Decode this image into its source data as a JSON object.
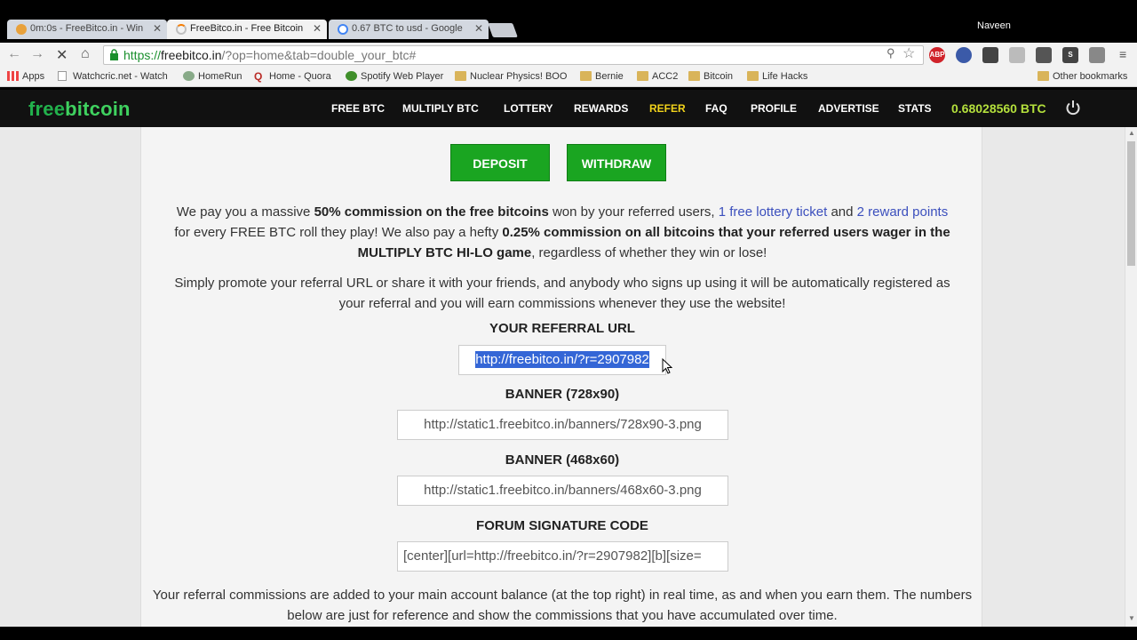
{
  "browser": {
    "tabs": [
      {
        "title": "0m:0s - FreeBitco.in - Win",
        "active": false
      },
      {
        "title": "FreeBitco.in - Free Bitcoin",
        "active": true
      },
      {
        "title": "0.67 BTC to usd - Google",
        "active": false
      }
    ],
    "user": "Naveen",
    "url_https": "https://",
    "url_host": "freebitco.in",
    "url_rest": "/?op=home&tab=double_your_btc#",
    "bookmarks": [
      {
        "label": "Apps",
        "icon": "apps-icon"
      },
      {
        "label": "Watchcric.net - Watch",
        "icon": "page-icon"
      },
      {
        "label": "HomeRun",
        "icon": "homerun-icon"
      },
      {
        "label": "Home - Quora",
        "icon": "quora-icon"
      },
      {
        "label": "Spotify Web Player",
        "icon": "spotify-icon"
      },
      {
        "label": "Nuclear Physics! BOO",
        "icon": "folder-icon"
      },
      {
        "label": "Bernie",
        "icon": "folder-icon"
      },
      {
        "label": "ACC2",
        "icon": "folder-icon"
      },
      {
        "label": "Bitcoin",
        "icon": "folder-icon"
      },
      {
        "label": "Life Hacks",
        "icon": "folder-icon"
      }
    ],
    "other_bookmarks": "Other bookmarks",
    "extensions": [
      "ABP"
    ]
  },
  "site": {
    "logo_a": "free",
    "logo_b": "bitcoin",
    "nav": [
      "FREE BTC",
      "MULTIPLY BTC",
      "LOTTERY",
      "REWARDS",
      "REFER",
      "FAQ",
      "PROFILE",
      "ADVERTISE",
      "STATS"
    ],
    "balance": "0.68028560 BTC"
  },
  "main": {
    "deposit": "DEPOSIT",
    "withdraw": "WITHDRAW",
    "p1": {
      "a": "We pay you a massive ",
      "b": "50% commission on the free bitcoins",
      "c": " won by your referred users, ",
      "d": "1 free lottery ticket",
      "e": " and ",
      "f": "2 reward points",
      "g": " for every FREE BTC roll they play! We also pay a hefty ",
      "h": "0.25% commission on all bitcoins that your referred users wager in the MULTIPLY BTC HI-LO game",
      "i": ", regardless of whether they win or lose!"
    },
    "p2": "Simply promote your referral URL or share it with your friends, and anybody who signs up using it will be automatically registered as your referral and you will earn commissions whenever they use the website!",
    "referral_label": "YOUR REFERRAL URL",
    "referral_url": "http://freebitco.in/?r=2907982",
    "banner1_label": "BANNER (728x90)",
    "banner1_url": "http://static1.freebitco.in/banners/728x90-3.png",
    "banner2_label": "BANNER (468x60)",
    "banner2_url": "http://static1.freebitco.in/banners/468x60-3.png",
    "forum_label": "FORUM SIGNATURE CODE",
    "forum_code": "[center][url=http://freebitco.in/?r=2907982][b][size=",
    "p3": "Your referral commissions are added to your main account balance (at the top right) in real time, as and when you earn them. The numbers below are just for reference and show the commissions that you have accumulated over time."
  },
  "colors": {
    "accent_green": "#1aa521",
    "refer_yellow": "#f2d31b",
    "balance_green": "#b4e03c",
    "link_blue": "#3b4fbd"
  }
}
